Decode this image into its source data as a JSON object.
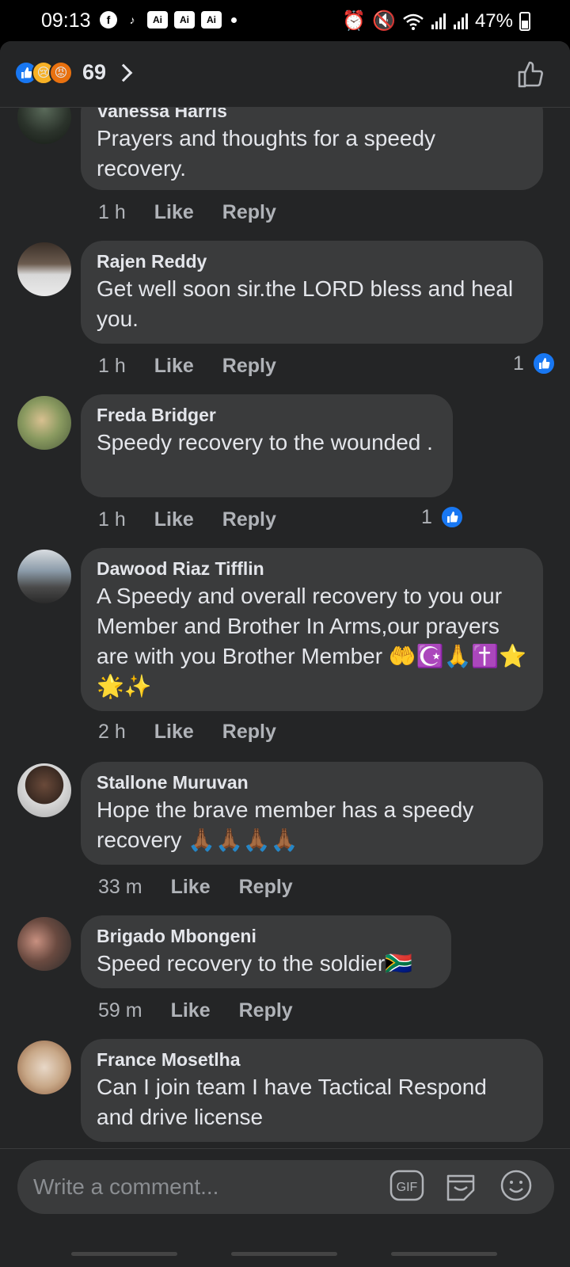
{
  "status_bar": {
    "time": "09:13",
    "battery": "47%",
    "left_icons": [
      "facebook-icon",
      "tiktok-icon",
      "ai-icon",
      "ai-icon",
      "ai-icon",
      "dot"
    ],
    "right_icons": [
      "alarm-icon",
      "mute-icon",
      "wifi-icon",
      "signal-icon",
      "signal-icon",
      "battery-icon"
    ],
    "ai_label": "Ai"
  },
  "header": {
    "reaction_count": "69",
    "reactions": [
      "like",
      "sad",
      "angry"
    ]
  },
  "comments": [
    {
      "author": "Vanessa Harris",
      "text": "Prayers and thoughts for a speedy recovery.",
      "time": "1 h",
      "like_label": "Like",
      "reply_label": "Reply",
      "likes": ""
    },
    {
      "author": "Rajen Reddy",
      "text": "Get well soon sir.the LORD bless and heal you.",
      "time": "1 h",
      "like_label": "Like",
      "reply_label": "Reply",
      "likes": "1"
    },
    {
      "author": "Freda Bridger",
      "text": "Speedy recovery to the wounded .",
      "time": "1 h",
      "like_label": "Like",
      "reply_label": "Reply",
      "likes": "1"
    },
    {
      "author": "Dawood Riaz Tifflin",
      "text": "A Speedy and overall recovery to you our Member and Brother In Arms,our prayers are with you Brother Member 🤲☪️🙏✝️⭐🌟✨",
      "time": "2 h",
      "like_label": "Like",
      "reply_label": "Reply",
      "likes": ""
    },
    {
      "author": "Stallone Muruvan",
      "text": "Hope the brave member has a speedy recovery 🙏🏾🙏🏾🙏🏾🙏🏾",
      "time": "33 m",
      "like_label": "Like",
      "reply_label": "Reply",
      "likes": ""
    },
    {
      "author": "Brigado Mbongeni",
      "text": "Speed recovery to the soldier🇿🇦",
      "time": "59 m",
      "like_label": "Like",
      "reply_label": "Reply",
      "likes": ""
    },
    {
      "author": "France Mosetlha",
      "text": "Can I join team I have Tactical Respond and drive license",
      "time": "",
      "like_label": "",
      "reply_label": "",
      "likes": ""
    }
  ],
  "composer": {
    "placeholder": "Write a comment...",
    "gif_label": "GIF",
    "icons": [
      "gif-icon",
      "sticker-icon",
      "emoji-icon"
    ]
  },
  "colors": {
    "background": "#242526",
    "bubble": "#3a3b3c",
    "like_blue": "#1877f2",
    "text": "#e4e6eb",
    "secondary_text": "#b0b3b8"
  }
}
